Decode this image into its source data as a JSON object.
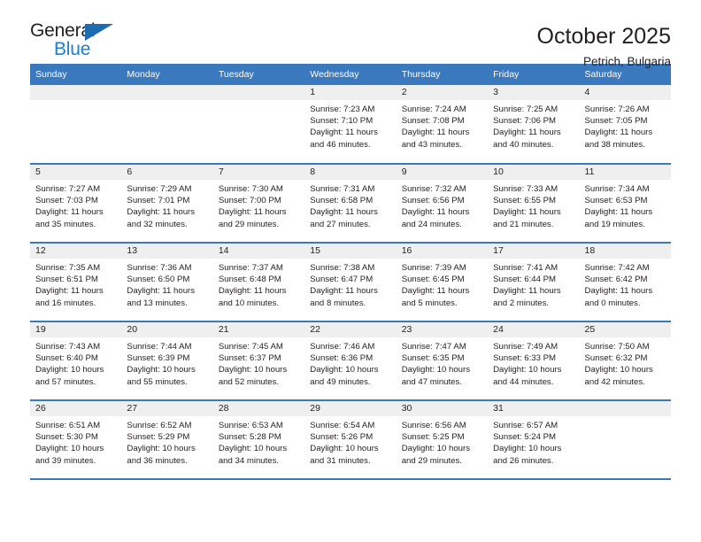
{
  "brand": {
    "name_top": "General",
    "name_bottom": "Blue",
    "accent_color": "#1b6cb0",
    "blue_text_color": "#1b7fd4"
  },
  "header": {
    "title": "October 2025",
    "location": "Petrich, Bulgaria"
  },
  "calendar": {
    "header_bg": "#3a79bd",
    "daynum_bg": "#efefef",
    "weekday_headers": [
      "Sunday",
      "Monday",
      "Tuesday",
      "Wednesday",
      "Thursday",
      "Friday",
      "Saturday"
    ],
    "weeks": [
      [
        {
          "day": ""
        },
        {
          "day": ""
        },
        {
          "day": ""
        },
        {
          "day": "1",
          "sunrise": "Sunrise: 7:23 AM",
          "sunset": "Sunset: 7:10 PM",
          "daylight": "Daylight: 11 hours and 46 minutes."
        },
        {
          "day": "2",
          "sunrise": "Sunrise: 7:24 AM",
          "sunset": "Sunset: 7:08 PM",
          "daylight": "Daylight: 11 hours and 43 minutes."
        },
        {
          "day": "3",
          "sunrise": "Sunrise: 7:25 AM",
          "sunset": "Sunset: 7:06 PM",
          "daylight": "Daylight: 11 hours and 40 minutes."
        },
        {
          "day": "4",
          "sunrise": "Sunrise: 7:26 AM",
          "sunset": "Sunset: 7:05 PM",
          "daylight": "Daylight: 11 hours and 38 minutes."
        }
      ],
      [
        {
          "day": "5",
          "sunrise": "Sunrise: 7:27 AM",
          "sunset": "Sunset: 7:03 PM",
          "daylight": "Daylight: 11 hours and 35 minutes."
        },
        {
          "day": "6",
          "sunrise": "Sunrise: 7:29 AM",
          "sunset": "Sunset: 7:01 PM",
          "daylight": "Daylight: 11 hours and 32 minutes."
        },
        {
          "day": "7",
          "sunrise": "Sunrise: 7:30 AM",
          "sunset": "Sunset: 7:00 PM",
          "daylight": "Daylight: 11 hours and 29 minutes."
        },
        {
          "day": "8",
          "sunrise": "Sunrise: 7:31 AM",
          "sunset": "Sunset: 6:58 PM",
          "daylight": "Daylight: 11 hours and 27 minutes."
        },
        {
          "day": "9",
          "sunrise": "Sunrise: 7:32 AM",
          "sunset": "Sunset: 6:56 PM",
          "daylight": "Daylight: 11 hours and 24 minutes."
        },
        {
          "day": "10",
          "sunrise": "Sunrise: 7:33 AM",
          "sunset": "Sunset: 6:55 PM",
          "daylight": "Daylight: 11 hours and 21 minutes."
        },
        {
          "day": "11",
          "sunrise": "Sunrise: 7:34 AM",
          "sunset": "Sunset: 6:53 PM",
          "daylight": "Daylight: 11 hours and 19 minutes."
        }
      ],
      [
        {
          "day": "12",
          "sunrise": "Sunrise: 7:35 AM",
          "sunset": "Sunset: 6:51 PM",
          "daylight": "Daylight: 11 hours and 16 minutes."
        },
        {
          "day": "13",
          "sunrise": "Sunrise: 7:36 AM",
          "sunset": "Sunset: 6:50 PM",
          "daylight": "Daylight: 11 hours and 13 minutes."
        },
        {
          "day": "14",
          "sunrise": "Sunrise: 7:37 AM",
          "sunset": "Sunset: 6:48 PM",
          "daylight": "Daylight: 11 hours and 10 minutes."
        },
        {
          "day": "15",
          "sunrise": "Sunrise: 7:38 AM",
          "sunset": "Sunset: 6:47 PM",
          "daylight": "Daylight: 11 hours and 8 minutes."
        },
        {
          "day": "16",
          "sunrise": "Sunrise: 7:39 AM",
          "sunset": "Sunset: 6:45 PM",
          "daylight": "Daylight: 11 hours and 5 minutes."
        },
        {
          "day": "17",
          "sunrise": "Sunrise: 7:41 AM",
          "sunset": "Sunset: 6:44 PM",
          "daylight": "Daylight: 11 hours and 2 minutes."
        },
        {
          "day": "18",
          "sunrise": "Sunrise: 7:42 AM",
          "sunset": "Sunset: 6:42 PM",
          "daylight": "Daylight: 11 hours and 0 minutes."
        }
      ],
      [
        {
          "day": "19",
          "sunrise": "Sunrise: 7:43 AM",
          "sunset": "Sunset: 6:40 PM",
          "daylight": "Daylight: 10 hours and 57 minutes."
        },
        {
          "day": "20",
          "sunrise": "Sunrise: 7:44 AM",
          "sunset": "Sunset: 6:39 PM",
          "daylight": "Daylight: 10 hours and 55 minutes."
        },
        {
          "day": "21",
          "sunrise": "Sunrise: 7:45 AM",
          "sunset": "Sunset: 6:37 PM",
          "daylight": "Daylight: 10 hours and 52 minutes."
        },
        {
          "day": "22",
          "sunrise": "Sunrise: 7:46 AM",
          "sunset": "Sunset: 6:36 PM",
          "daylight": "Daylight: 10 hours and 49 minutes."
        },
        {
          "day": "23",
          "sunrise": "Sunrise: 7:47 AM",
          "sunset": "Sunset: 6:35 PM",
          "daylight": "Daylight: 10 hours and 47 minutes."
        },
        {
          "day": "24",
          "sunrise": "Sunrise: 7:49 AM",
          "sunset": "Sunset: 6:33 PM",
          "daylight": "Daylight: 10 hours and 44 minutes."
        },
        {
          "day": "25",
          "sunrise": "Sunrise: 7:50 AM",
          "sunset": "Sunset: 6:32 PM",
          "daylight": "Daylight: 10 hours and 42 minutes."
        }
      ],
      [
        {
          "day": "26",
          "sunrise": "Sunrise: 6:51 AM",
          "sunset": "Sunset: 5:30 PM",
          "daylight": "Daylight: 10 hours and 39 minutes."
        },
        {
          "day": "27",
          "sunrise": "Sunrise: 6:52 AM",
          "sunset": "Sunset: 5:29 PM",
          "daylight": "Daylight: 10 hours and 36 minutes."
        },
        {
          "day": "28",
          "sunrise": "Sunrise: 6:53 AM",
          "sunset": "Sunset: 5:28 PM",
          "daylight": "Daylight: 10 hours and 34 minutes."
        },
        {
          "day": "29",
          "sunrise": "Sunrise: 6:54 AM",
          "sunset": "Sunset: 5:26 PM",
          "daylight": "Daylight: 10 hours and 31 minutes."
        },
        {
          "day": "30",
          "sunrise": "Sunrise: 6:56 AM",
          "sunset": "Sunset: 5:25 PM",
          "daylight": "Daylight: 10 hours and 29 minutes."
        },
        {
          "day": "31",
          "sunrise": "Sunrise: 6:57 AM",
          "sunset": "Sunset: 5:24 PM",
          "daylight": "Daylight: 10 hours and 26 minutes."
        },
        {
          "day": ""
        }
      ]
    ]
  }
}
